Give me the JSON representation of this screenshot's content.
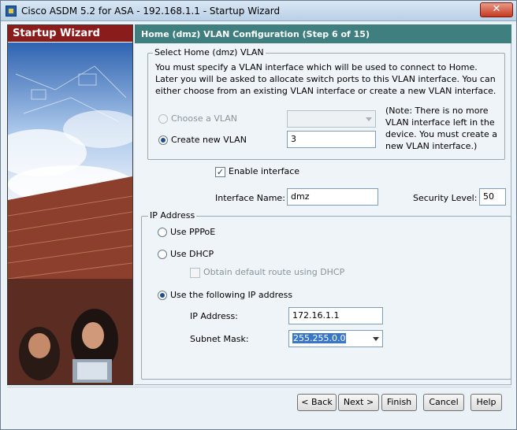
{
  "window": {
    "title": "Cisco ASDM 5.2 for ASA - 192.168.1.1 - Startup Wizard",
    "close_glyph": "✕"
  },
  "sidebar": {
    "header": "Startup Wizard"
  },
  "step_header": "Home (dmz) VLAN Configuration  (Step 6 of 15)",
  "vlan_group": {
    "legend": "Select Home (dmz) VLAN",
    "description": "You must specify a VLAN interface which will be used to connect to Home. Later you will be asked to allocate switch ports to this VLAN interface. You can either choose from an existing VLAN interface or create a new VLAN interface.",
    "choose_label": "Choose a VLAN",
    "choose_value": "",
    "create_label": "Create new VLAN",
    "create_value": "3",
    "note": "(Note: There is no more VLAN interface left in the device. You must create a new VLAN interface.)"
  },
  "interface": {
    "enable_label": "Enable interface",
    "enable_checked": true,
    "name_label": "Interface Name:",
    "name_value": "dmz",
    "security_label": "Security Level:",
    "security_value": "50"
  },
  "ip_group": {
    "legend": "IP Address",
    "pppoe_label": "Use PPPoE",
    "dhcp_label": "Use DHCP",
    "dhcp_route_label": "Obtain default route using DHCP",
    "static_label": "Use the following IP address",
    "ip_label": "IP Address:",
    "ip_value": "172.16.1.1",
    "mask_label": "Subnet Mask:",
    "mask_value": "255.255.0.0"
  },
  "buttons": {
    "back": "< Back",
    "next": "Next >",
    "finish": "Finish",
    "cancel": "Cancel",
    "help": "Help"
  },
  "colors": {
    "header_bar": "#3f7f7f",
    "sidebar_header": "#8a1c1c",
    "selection": "#3a76c8"
  }
}
